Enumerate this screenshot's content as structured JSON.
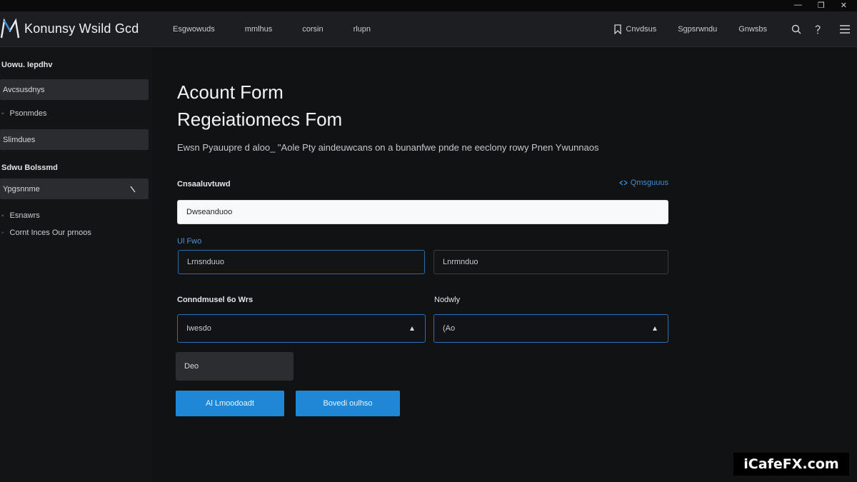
{
  "window": {
    "controls": [
      "—",
      "❐",
      "✕"
    ]
  },
  "header": {
    "logo_letter": "M",
    "title": "Konunsy Wsild Gcd",
    "nav_left": [
      "Esgwowuds",
      "mmlhus",
      "corsin",
      "rlupn"
    ],
    "nav_right": [
      "Cnvdsus",
      "Sgpsrwndu",
      "Gnwsbs"
    ],
    "icons": [
      "search-icon",
      "help-icon",
      "menu-icon"
    ]
  },
  "sidebar": {
    "heading_1": "Uowu. Iepdhv",
    "box_1": "Avcsusdnys",
    "link_1": "Psonmdes",
    "box_2": "Slimdues",
    "heading_2": "Sdwu Bolssmd",
    "box_3": "Ypgsnnme",
    "link_2": "Esnawrs",
    "link_3": "Cornt Inces Our prnoos"
  },
  "main": {
    "title_1": "Acount Form",
    "title_2": "Regeiatiomecs Fom",
    "description": "Ewsn Pyauupre d aloo_ \"Aole Pty aindeuwcans on a bunanfwe pnde ne eeclony rowy Pnen Ywunnaos",
    "label_account": "Cnsaaluvtuwd",
    "link_right": "Qmsguuus",
    "field_1": "Dwseanduoo",
    "label_blue": "Ul Fwo",
    "field_2": "Lrnsnduuo",
    "field_3": "Lnrmnduo",
    "label_conn": "Conndmusel 6o Wrs",
    "label_mode": "Nodwly",
    "select_1": "Iwesdo",
    "select_2": "(Ao",
    "field_dark": "Deo",
    "button_1": "Al Lmoodoadt",
    "button_2": "Bovedi oulhso"
  },
  "watermark": "iCafeFX.com",
  "colors": {
    "accent": "#1e88d6",
    "header_bg": "#1d1e21",
    "page_bg": "#111214"
  }
}
